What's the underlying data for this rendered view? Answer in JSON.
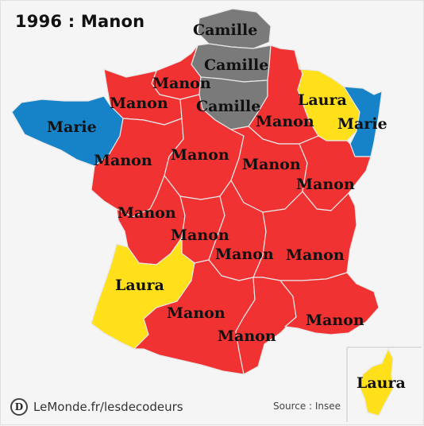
{
  "title": "1996 : Manon",
  "colors": {
    "Manon": "#f03232",
    "Camille": "#7a7a7a",
    "Laura": "#ffe01a",
    "Marie": "#1683c8",
    "border": "#e8e8e8",
    "background": "#f5f5f5"
  },
  "regions": [
    {
      "id": "nord",
      "name_shown": "Camille"
    },
    {
      "id": "picardie",
      "name_shown": "Camille"
    },
    {
      "id": "haute-normandie",
      "name_shown": "Manon"
    },
    {
      "id": "ile-de-france",
      "name_shown": "Camille"
    },
    {
      "id": "basse-normandie",
      "name_shown": "Manon"
    },
    {
      "id": "champagne-ardenne",
      "name_shown": "Manon"
    },
    {
      "id": "lorraine",
      "name_shown": "Laura"
    },
    {
      "id": "alsace",
      "name_shown": "Marie"
    },
    {
      "id": "bretagne",
      "name_shown": "Marie"
    },
    {
      "id": "pays-de-la-loire",
      "name_shown": "Manon"
    },
    {
      "id": "centre",
      "name_shown": "Manon"
    },
    {
      "id": "bourgogne",
      "name_shown": "Manon"
    },
    {
      "id": "franche-comte",
      "name_shown": "Manon"
    },
    {
      "id": "poitou-charentes",
      "name_shown": "Manon"
    },
    {
      "id": "limousin",
      "name_shown": "Manon"
    },
    {
      "id": "auvergne",
      "name_shown": "Manon"
    },
    {
      "id": "rhone-alpes",
      "name_shown": "Manon"
    },
    {
      "id": "aquitaine",
      "name_shown": "Laura"
    },
    {
      "id": "midi-pyrenees",
      "name_shown": "Manon"
    },
    {
      "id": "languedoc-roussillon",
      "name_shown": "Manon"
    },
    {
      "id": "provence-alpes-cote-dazur",
      "name_shown": "Manon"
    },
    {
      "id": "corse",
      "name_shown": "Laura"
    }
  ],
  "footer": {
    "brand_logo_letter": "D",
    "brand": "LeMonde.fr/lesdecodeurs",
    "source": "Source : Insee"
  }
}
